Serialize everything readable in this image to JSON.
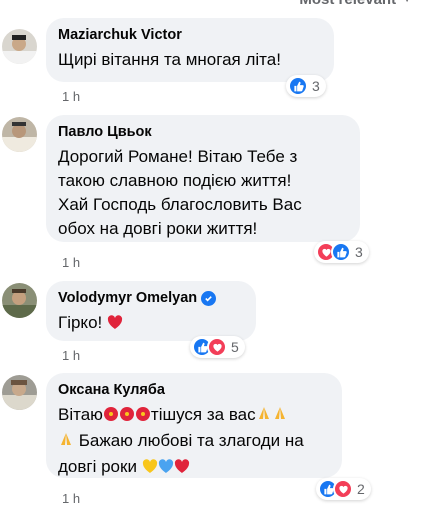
{
  "sort": {
    "label": "Most relevant"
  },
  "comments": [
    {
      "author": "Maziarchuk Victor",
      "text": "Щирі вітання та многая літа!",
      "time": "1 h",
      "reaction_count": "3"
    },
    {
      "author": "Павло Цвьок",
      "lines": [
        "Дорогий Романе! Вітаю Тебе з",
        "такою славною подією життя!",
        "Хай Господь благословить Вас",
        "обох на довгі роки життя!"
      ],
      "time": "1 h",
      "reaction_count": "3"
    },
    {
      "author": "Volodymyr Omelyan",
      "text": "Гірко!",
      "time": "1 h",
      "reaction_count": "5"
    },
    {
      "author": "Оксана Куляба",
      "line1_pre": "Вітаю",
      "line1_mid": "тішуся за вас",
      "line2": "Бажаю любові та злагоди на",
      "line3": "довгі роки",
      "time": "1 h",
      "reaction_count": "2"
    }
  ],
  "colors": {
    "like": "#1877f2",
    "love": "#f33e58",
    "bubble": "#f0f2f5"
  },
  "icons": [
    "thumbs-up-icon",
    "heart-icon",
    "verified-badge-icon",
    "hibiscus-emoji",
    "praying-hands-emoji",
    "yellow-heart-emoji",
    "blue-heart-emoji",
    "red-heart-emoji"
  ]
}
